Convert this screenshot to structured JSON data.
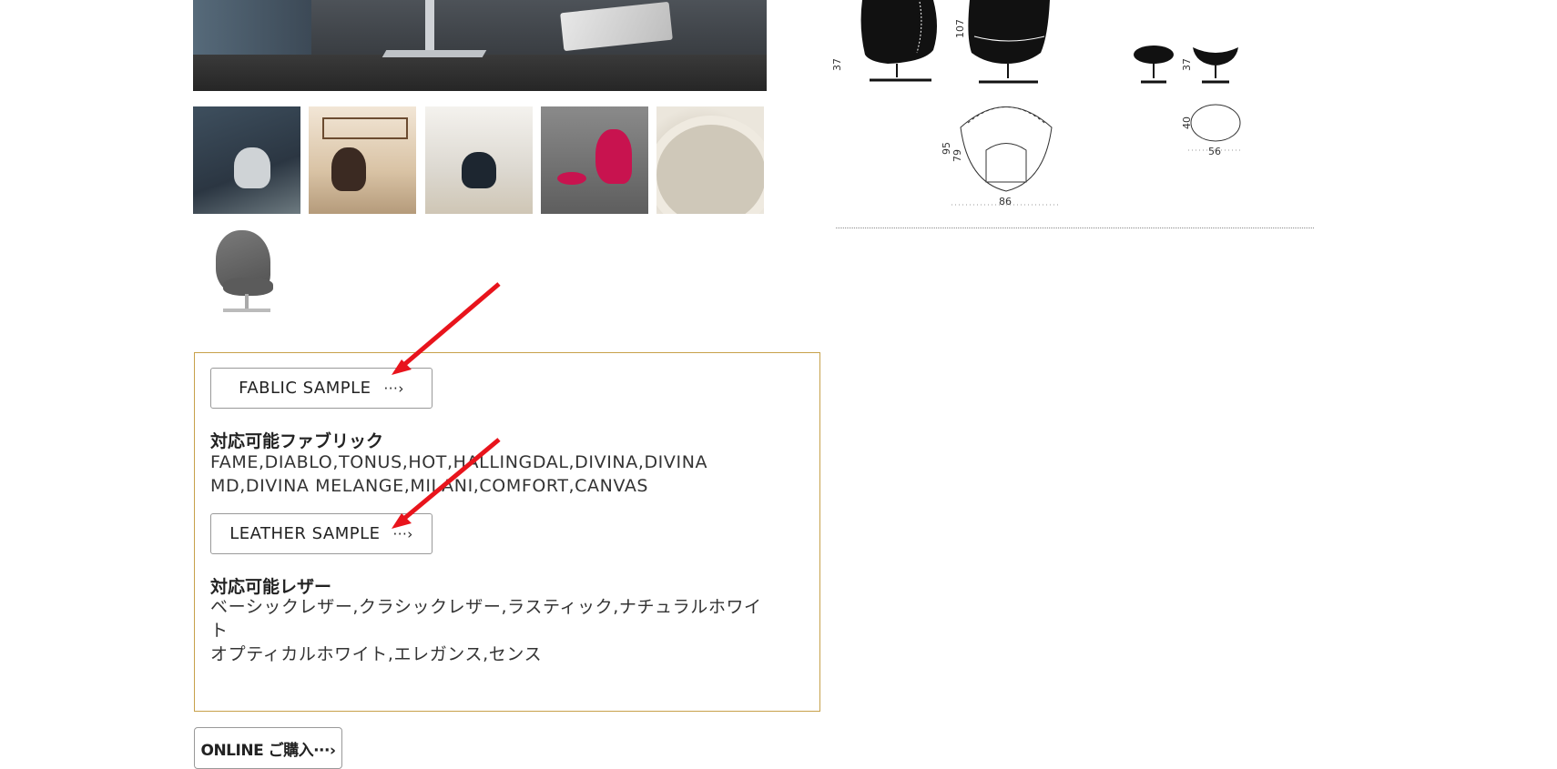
{
  "gallery": {
    "thumbnails": [
      "thumb-1",
      "thumb-2",
      "thumb-3",
      "thumb-4",
      "thumb-5"
    ]
  },
  "dimensions": {
    "chair_height": "107",
    "chair_seat_height": "37",
    "chair_depth_outer": "95",
    "chair_depth_inner": "79",
    "chair_width": "86",
    "ottoman_height": "37",
    "ottoman_depth": "40",
    "ottoman_width": "56"
  },
  "samples": {
    "fabric_button_label": "FABLIC SAMPLE",
    "fabric_heading": "対応可能ファブリック",
    "fabric_list_line1": "FAME,DIABLO,TONUS,HOT,HALLINGDAL,DIVINA,DIVINA",
    "fabric_list_line2": "MD,DIVINA MELANGE,MILANI,COMFORT,CANVAS",
    "leather_button_label": "LEATHER SAMPLE",
    "leather_heading": "対応可能レザー",
    "leather_list_line1": "ベーシックレザー,クラシックレザー,ラスティック,ナチュラルホワイ",
    "leather_list_line2": "ト",
    "leather_list_line3": "オプティカルホワイト,エレガンス,センス",
    "arrow_glyph": "···›"
  },
  "online": {
    "label": "ONLINE ご購入···›"
  },
  "annotation": {
    "arrow_color": "#e8141c"
  }
}
